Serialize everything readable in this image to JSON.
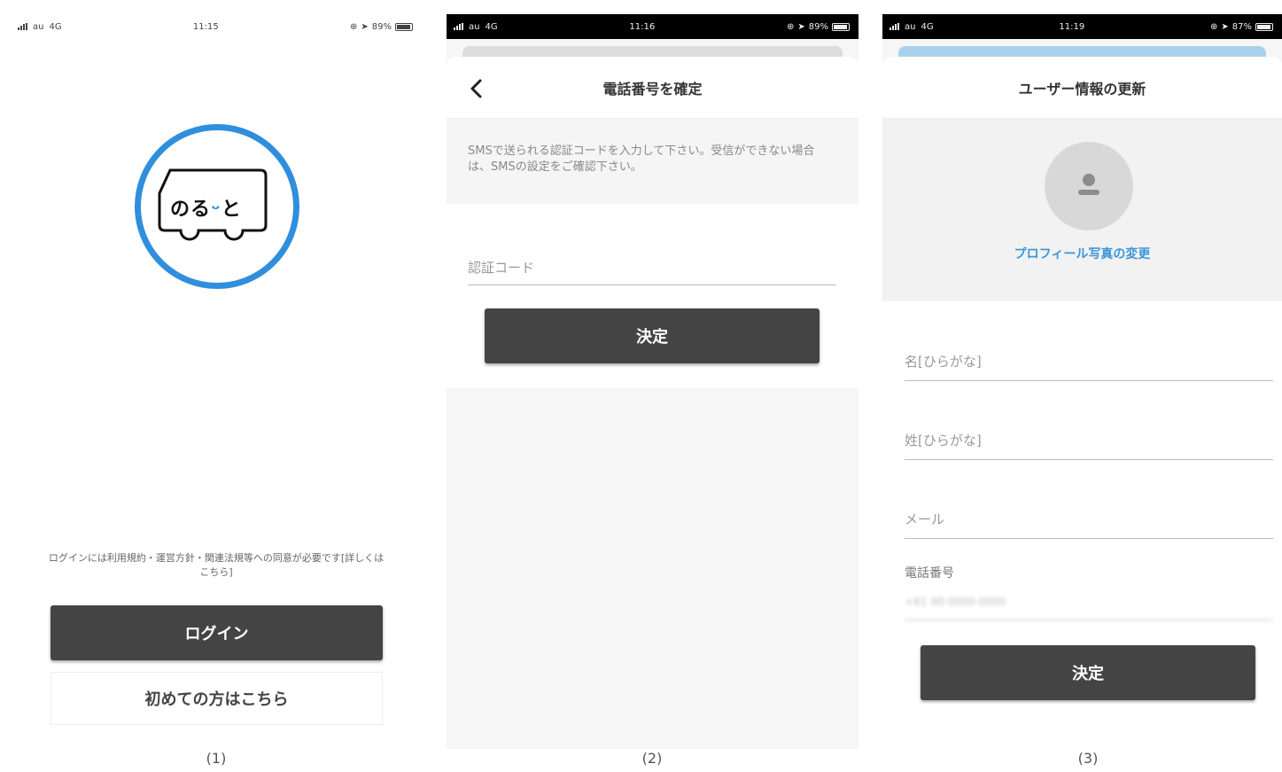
{
  "status_bars": [
    {
      "carrier": "au",
      "network": "4G",
      "time": "11:15",
      "battery": "89%"
    },
    {
      "carrier": "au",
      "network": "4G",
      "time": "11:16",
      "battery": "89%"
    },
    {
      "carrier": "au",
      "network": "4G",
      "time": "11:19",
      "battery": "87%"
    }
  ],
  "screen1": {
    "logo_text_a": "のる",
    "logo_smile": "ᵕ",
    "logo_text_b": "と",
    "terms": "ログインには利用規約・運営方針・関連法規等への同意が必要です[詳しくはこちら]",
    "login_label": "ログイン",
    "first_time_label": "初めての方はこちら"
  },
  "screen2": {
    "title": "電話番号を確定",
    "info": "SMSで送られる認証コードを入力して下さい。受信ができない場合は、SMSの設定をご確認下さい。",
    "code_placeholder": "認証コード",
    "submit_label": "決定"
  },
  "screen3": {
    "title": "ユーザー情報の更新",
    "change_photo": "プロフィール写真の変更",
    "given_kana_placeholder": "名[ひらがな]",
    "family_kana_placeholder": "姓[ひらがな]",
    "email_placeholder": "メール",
    "phone_label": "電話番号",
    "phone_value": "+81 90-0000-0000",
    "submit_label": "決定"
  },
  "captions": [
    "(1)",
    "(2)",
    "(3)"
  ],
  "colors": {
    "accent": "#2f8fdc",
    "button": "#444444",
    "link": "#3a96d8"
  }
}
